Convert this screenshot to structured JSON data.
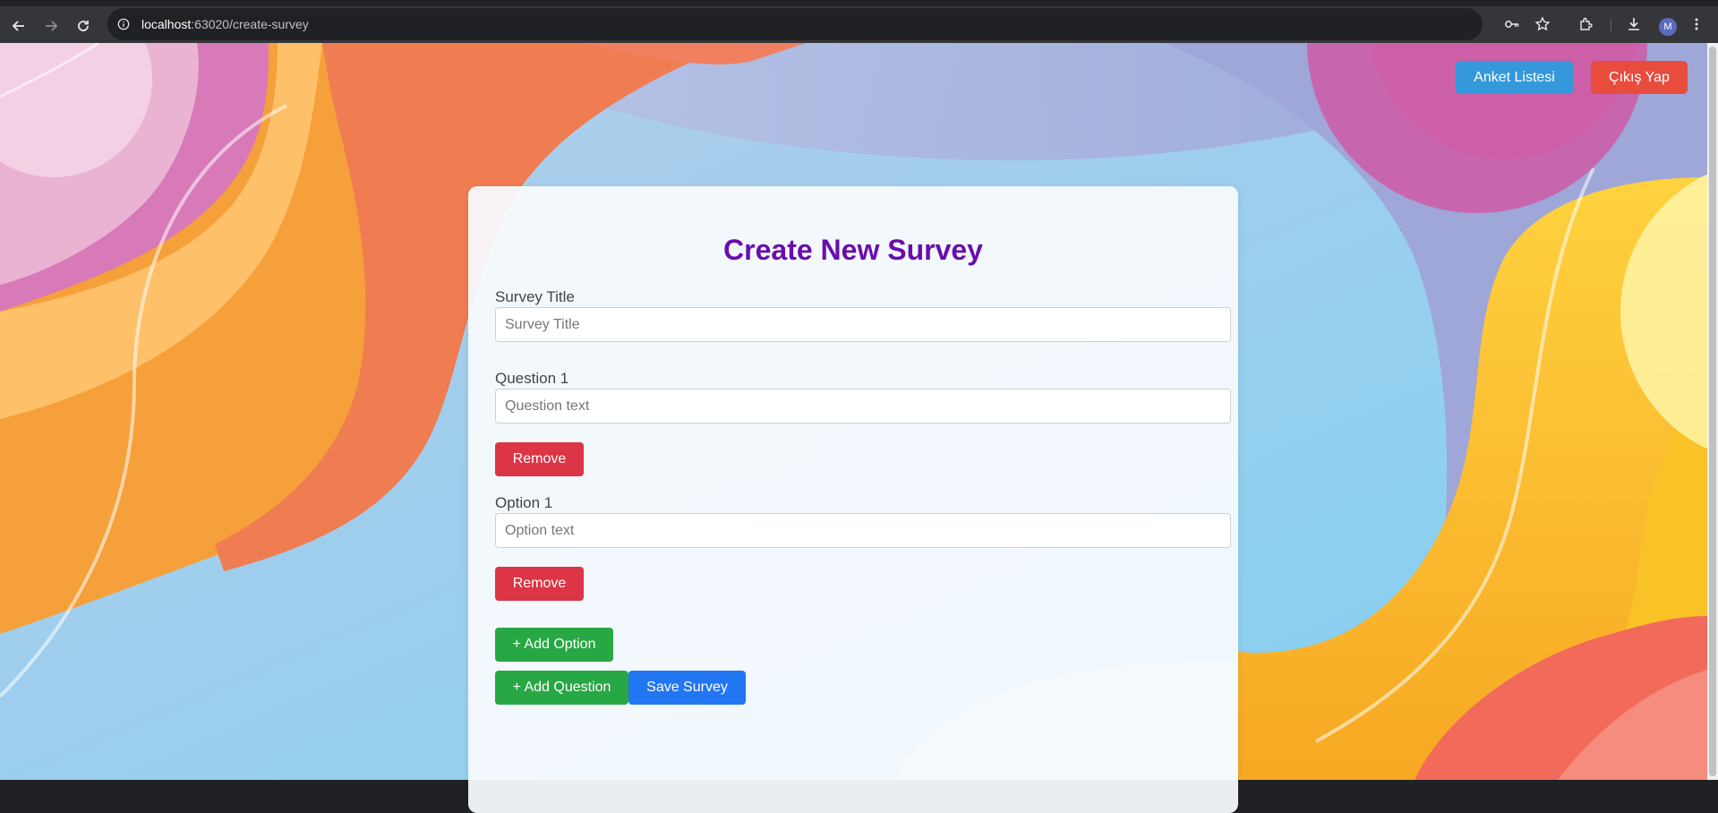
{
  "browser": {
    "url_host": "localhost",
    "url_path": ":63020/create-survey",
    "avatar_letter": "M",
    "icons": [
      "back-icon",
      "forward-icon",
      "reload-icon",
      "info-icon",
      "key-icon",
      "star-icon",
      "extensions-icon",
      "download-icon",
      "menu-icon"
    ]
  },
  "header": {
    "survey_list_label": "Anket Listesi",
    "logout_label": "Çıkış Yap"
  },
  "form": {
    "title": "Create New Survey",
    "survey_title_label": "Survey Title",
    "survey_title_placeholder": "Survey Title",
    "survey_title_value": "",
    "questions": [
      {
        "label": "Question 1",
        "placeholder": "Question text",
        "value": "",
        "remove_label": "Remove",
        "options": [
          {
            "label": "Option 1",
            "placeholder": "Option text",
            "value": "",
            "remove_label": "Remove"
          }
        ],
        "add_option_label": "+ Add Option"
      }
    ],
    "add_question_label": "+ Add Question",
    "save_label": "Save Survey"
  },
  "colors": {
    "title": "#6a0dad",
    "remove": "#dc3545",
    "add": "#28a745",
    "save": "#2276f2",
    "survey_list": "#3498db",
    "logout": "#e74c3c"
  }
}
